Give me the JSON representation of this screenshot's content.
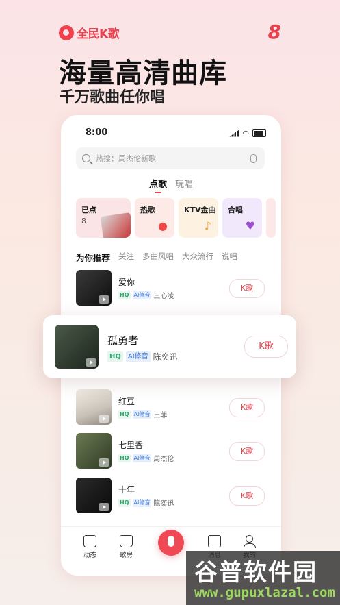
{
  "brand": {
    "name": "全民K歌",
    "version_mark": "8"
  },
  "hero": {
    "title": "海量高清曲库",
    "subtitle": "千万歌曲任你唱"
  },
  "status_bar": {
    "time": "8:00"
  },
  "search": {
    "placeholder": "热搜：周杰伦新歌"
  },
  "tabs": [
    {
      "label": "点歌",
      "active": true
    },
    {
      "label": "玩唱",
      "active": false
    }
  ],
  "cards": [
    {
      "label": "已点",
      "count": "8"
    },
    {
      "label": "热歌"
    },
    {
      "label": "KTV金曲"
    },
    {
      "label": "合唱"
    }
  ],
  "subtabs": [
    "为你推荐",
    "关注",
    "多曲风唱",
    "大众流行",
    "说唱"
  ],
  "songs": [
    {
      "title": "爱你",
      "hq": "HQ",
      "ai": "AI修音",
      "artist": "王心凌",
      "action": "K歌"
    },
    {
      "title": "孤勇者",
      "hq": "HQ",
      "ai": "AI修音",
      "artist": "陈奕迅",
      "action": "K歌"
    },
    {
      "title": "红豆",
      "hq": "HQ",
      "ai": "AI修音",
      "artist": "王菲",
      "action": "K歌"
    },
    {
      "title": "七里香",
      "hq": "HQ",
      "ai": "AI修音",
      "artist": "周杰伦",
      "action": "K歌"
    },
    {
      "title": "十年",
      "hq": "HQ",
      "ai": "AI修音",
      "artist": "陈奕迅",
      "action": "K歌"
    }
  ],
  "nav": [
    "动态",
    "歌房",
    "消息",
    "我的"
  ],
  "watermark": {
    "big": "谷普软件园",
    "small": "www.gupuxlazal.com"
  },
  "colors": {
    "accent": "#e8424f",
    "hq": "#2aa66a",
    "ai": "#3a78d6"
  }
}
